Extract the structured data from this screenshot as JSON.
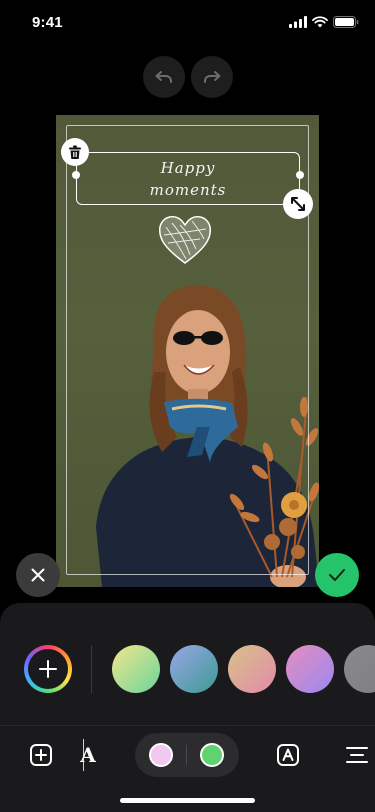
{
  "status_bar": {
    "time": "9:41"
  },
  "editor": {
    "undo_icon": "undo-arrow-icon",
    "redo_icon": "redo-arrow-icon",
    "text_sticker": {
      "line1": "Happy",
      "line2": "moments"
    }
  },
  "actions": {
    "cancel_icon": "close-icon",
    "confirm_icon": "checkmark-icon",
    "confirm_color": "#26c46a"
  },
  "palette": {
    "picker_icon": "add-color-icon",
    "swatches": [
      {
        "name": "yellow-green",
        "from": "#f3e58c",
        "to": "#6bd59b"
      },
      {
        "name": "blue-teal",
        "from": "#9aa6e6",
        "to": "#3b9b94"
      },
      {
        "name": "peach-pink",
        "from": "#d7c28a",
        "to": "#e38aa8"
      },
      {
        "name": "pink-violet",
        "from": "#e58fbe",
        "to": "#9b87f0"
      },
      {
        "name": "grey",
        "from": "#8a8a8e",
        "to": "#7d7d82"
      }
    ]
  },
  "toolbar": {
    "add_icon": "add-square-icon",
    "font_glyph": "A",
    "text_color": "#f0c8f0",
    "background_color": "#5fd36f",
    "text_style_icon": "text-style-box-icon",
    "align_icon": "align-center-icon"
  }
}
